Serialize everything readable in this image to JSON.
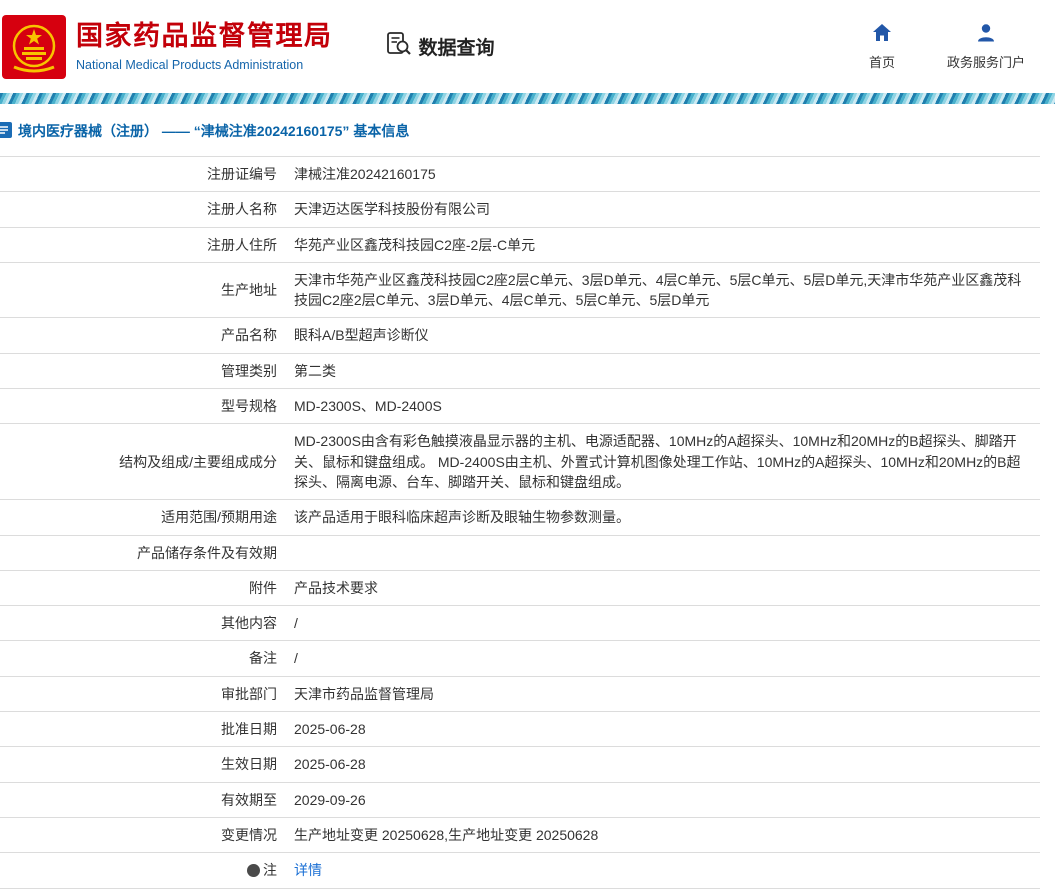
{
  "header": {
    "org_name_cn": "国家药品监督管理局",
    "org_name_en": "National Medical Products Administration",
    "section_title": "数据查询",
    "nav": [
      {
        "label": "首页",
        "icon": "home-icon"
      },
      {
        "label": "政务服务门户",
        "icon": "user-icon"
      }
    ]
  },
  "breadcrumb": {
    "text": "境内医疗器械（注册） —— “津械注准20242160175” 基本信息"
  },
  "table": {
    "rows": [
      {
        "label": "注册证编号",
        "value": "津械注准20242160175"
      },
      {
        "label": "注册人名称",
        "value": "天津迈达医学科技股份有限公司"
      },
      {
        "label": "注册人住所",
        "value": "华苑产业区鑫茂科技园C2座-2层-C单元"
      },
      {
        "label": "生产地址",
        "value": "天津市华苑产业区鑫茂科技园C2座2层C单元、3层D单元、4层C单元、5层C单元、5层D单元,天津市华苑产业区鑫茂科技园C2座2层C单元、3层D单元、4层C单元、5层C单元、5层D单元"
      },
      {
        "label": "产品名称",
        "value": "眼科A/B型超声诊断仪"
      },
      {
        "label": "管理类别",
        "value": "第二类"
      },
      {
        "label": "型号规格",
        "value": "MD-2300S、MD-2400S"
      },
      {
        "label": "结构及组成/主要组成成分",
        "value": "MD-2300S由含有彩色触摸液晶显示器的主机、电源适配器、10MHz的A超探头、10MHz和20MHz的B超探头、脚踏开关、鼠标和键盘组成。 MD-2400S由主机、外置式计算机图像处理工作站、10MHz的A超探头、10MHz和20MHz的B超探头、隔离电源、台车、脚踏开关、鼠标和键盘组成。"
      },
      {
        "label": "适用范围/预期用途",
        "value": "该产品适用于眼科临床超声诊断及眼轴生物参数测量。"
      },
      {
        "label": "产品储存条件及有效期",
        "value": ""
      },
      {
        "label": "附件",
        "value": "产品技术要求"
      },
      {
        "label": "其他内容",
        "value": "/"
      },
      {
        "label": "备注",
        "value": "/"
      },
      {
        "label": "审批部门",
        "value": "天津市药品监督管理局"
      },
      {
        "label": "批准日期",
        "value": "2025-06-28"
      },
      {
        "label": "生效日期",
        "value": "2025-06-28"
      },
      {
        "label": "有效期至",
        "value": "2029-09-26"
      },
      {
        "label": "变更情况",
        "value": "生产地址变更 20250628,生产地址变更 20250628"
      },
      {
        "label": "注",
        "label_icon": true,
        "value": "详情",
        "link": true
      }
    ]
  },
  "colors": {
    "brand_red": "#c30009",
    "brand_blue": "#1565ab",
    "breadcrumb_blue": "#0a64a8",
    "link_blue": "#1a6fd4",
    "strip_teal": "#49b0cc",
    "border_gray": "#dcdcdc"
  }
}
